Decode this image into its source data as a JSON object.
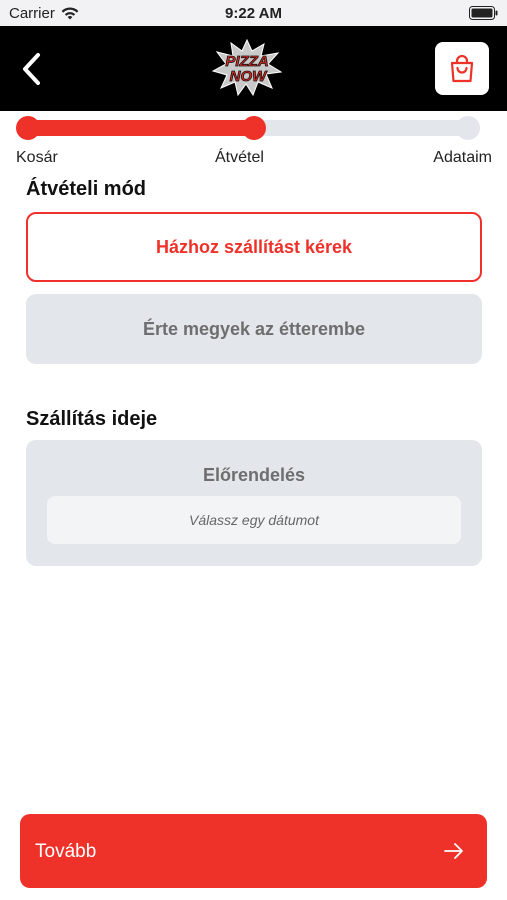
{
  "status_bar": {
    "carrier": "Carrier",
    "time": "9:22 AM",
    "icons": [
      "wifi-icon",
      "battery-icon"
    ]
  },
  "header": {
    "back_icon": "chevron-left-icon",
    "logo_line1": "PIZZA",
    "logo_line2": "NOW",
    "cart_icon": "shopping-bag-icon"
  },
  "stepper": {
    "steps": [
      "Kosár",
      "Átvétel",
      "Adataim"
    ],
    "current_step": 2,
    "progress_fraction": 0.5
  },
  "pickup": {
    "title": "Átvételi mód",
    "options": [
      {
        "label": "Házhoz szállítást kérek",
        "selected": true
      },
      {
        "label": "Érte megyek az étterembe",
        "selected": false
      }
    ]
  },
  "delivery_time": {
    "title": "Szállítás ideje",
    "preorder_label": "Előrendelés",
    "date_placeholder": "Válassz egy dátumot"
  },
  "footer": {
    "next_label": "Tovább",
    "next_icon": "arrow-right-icon"
  },
  "colors": {
    "accent": "#ee3229",
    "header_bg": "#000000",
    "muted_bg": "#e3e6ea",
    "muted_text": "#6e6e6e"
  }
}
